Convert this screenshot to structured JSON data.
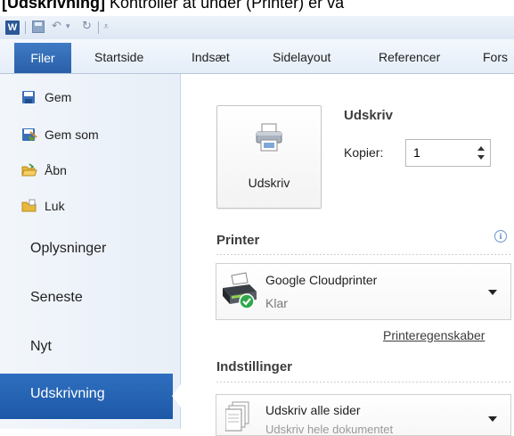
{
  "caption": {
    "bold": "[Udskrivning]",
    "rest": " Kontroller at under (Printer) er va"
  },
  "app": {
    "icon_letter": "W"
  },
  "ribbon": {
    "tabs": [
      "Filer",
      "Startside",
      "Indsæt",
      "Sidelayout",
      "Referencer",
      "Fors"
    ]
  },
  "backstage": {
    "commands": [
      "Gem",
      "Gem som",
      "Åbn",
      "Luk"
    ],
    "sections": [
      "Oplysninger",
      "Seneste",
      "Nyt",
      "Udskrivning"
    ]
  },
  "print": {
    "button_label": "Udskriv",
    "title": "Udskriv",
    "copies_label": "Kopier:",
    "copies_value": "1"
  },
  "printer": {
    "heading": "Printer",
    "info_glyph": "i",
    "name": "Google Cloudprinter",
    "status": "Klar",
    "properties_link": "Printeregenskaber"
  },
  "settings": {
    "heading": "Indstillinger",
    "pages_label": "Udskriv alle sider",
    "pages_sub": "Udskriv hele dokumentet"
  }
}
